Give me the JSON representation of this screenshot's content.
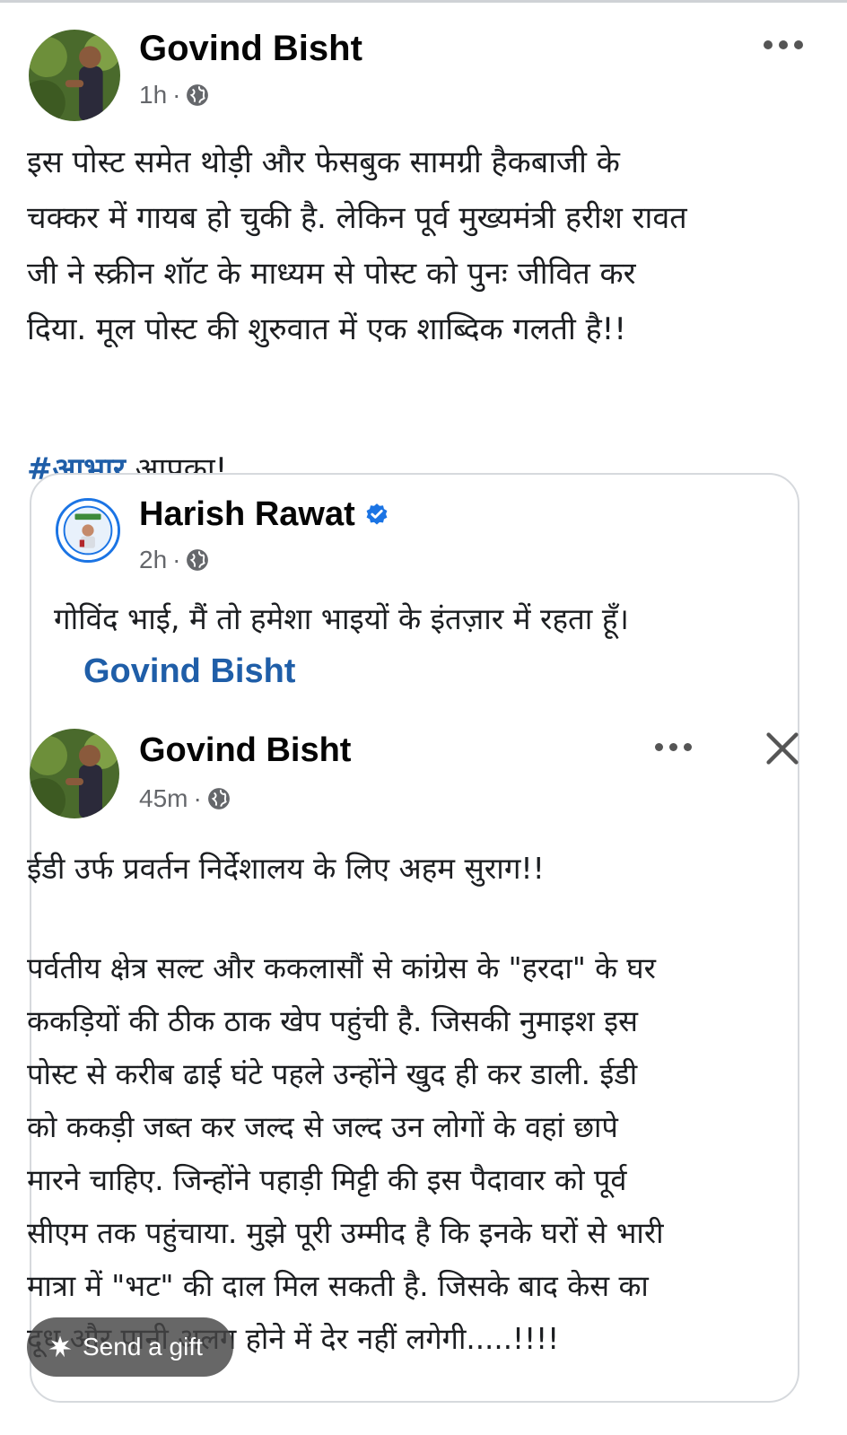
{
  "outer_post": {
    "author": "Govind Bisht",
    "time": "1h",
    "separator": "·",
    "text": "इस पोस्ट समेत थोड़ी और फेसबुक सामग्री हैकबाजी के\nचक्कर में गायब हो चुकी है. लेकिन पूर्व मुख्यमंत्री हरीश रावत\nजी ने स्क्रीन शॉट के माध्यम से पोस्ट को पुनः जीवित कर\nदिया. मूल पोस्ट की शुरुवात में एक शाब्दिक गलती है!!",
    "hashtag": "#आभार",
    "hashtag_suffix": " आपका!"
  },
  "shared_post": {
    "author": "Harish Rawat",
    "time": "2h",
    "separator": "·",
    "text": "गोविंद भाई, मैं तो हमेशा भाइयों के इंतज़ार में रहता हूँ।",
    "mention": "Govind Bisht"
  },
  "screenshot_post": {
    "author": "Govind Bisht",
    "time": "45m",
    "separator": "·",
    "text_line1": "ईडी उर्फ प्रवर्तन निर्देशालय के लिए अहम सुराग!!",
    "text_body": "पर्वतीय क्षेत्र सल्ट और ककलासौं से कांग्रेस के \"हरदा\" के घर\nककड़ियों की ठीक ठाक खेप पहुंची है. जिसकी नुमाइश इस\nपोस्ट से करीब ढाई घंटे पहले उन्होंने खुद ही कर डाली. ईडी\nको ककड़ी जब्त कर जल्द से जल्द उन लोगों के वहां छापे\nमारने चाहिए. जिन्होंने पहाड़ी मिट्टी की इस पैदावार को पूर्व\nसीएम तक पहुंचाया. मुझे पूरी उम्मीद है कि इनके घरों से भारी\nमात्रा में \"भट\" की दाल मिल सकती है. जिसके बाद केस का\nदूध और पानी अलग होने में देर नहीं लगेगी.....!!!!"
  },
  "gift_button": {
    "label": "Send a gift"
  },
  "icons": {
    "more": "more-dots-icon",
    "globe": "globe-icon",
    "verified": "verified-badge-icon",
    "close": "close-icon",
    "gift": "gift-icon"
  },
  "colors": {
    "link": "#1f5ea8",
    "meta": "#65676b",
    "verified": "#1b74e4"
  }
}
